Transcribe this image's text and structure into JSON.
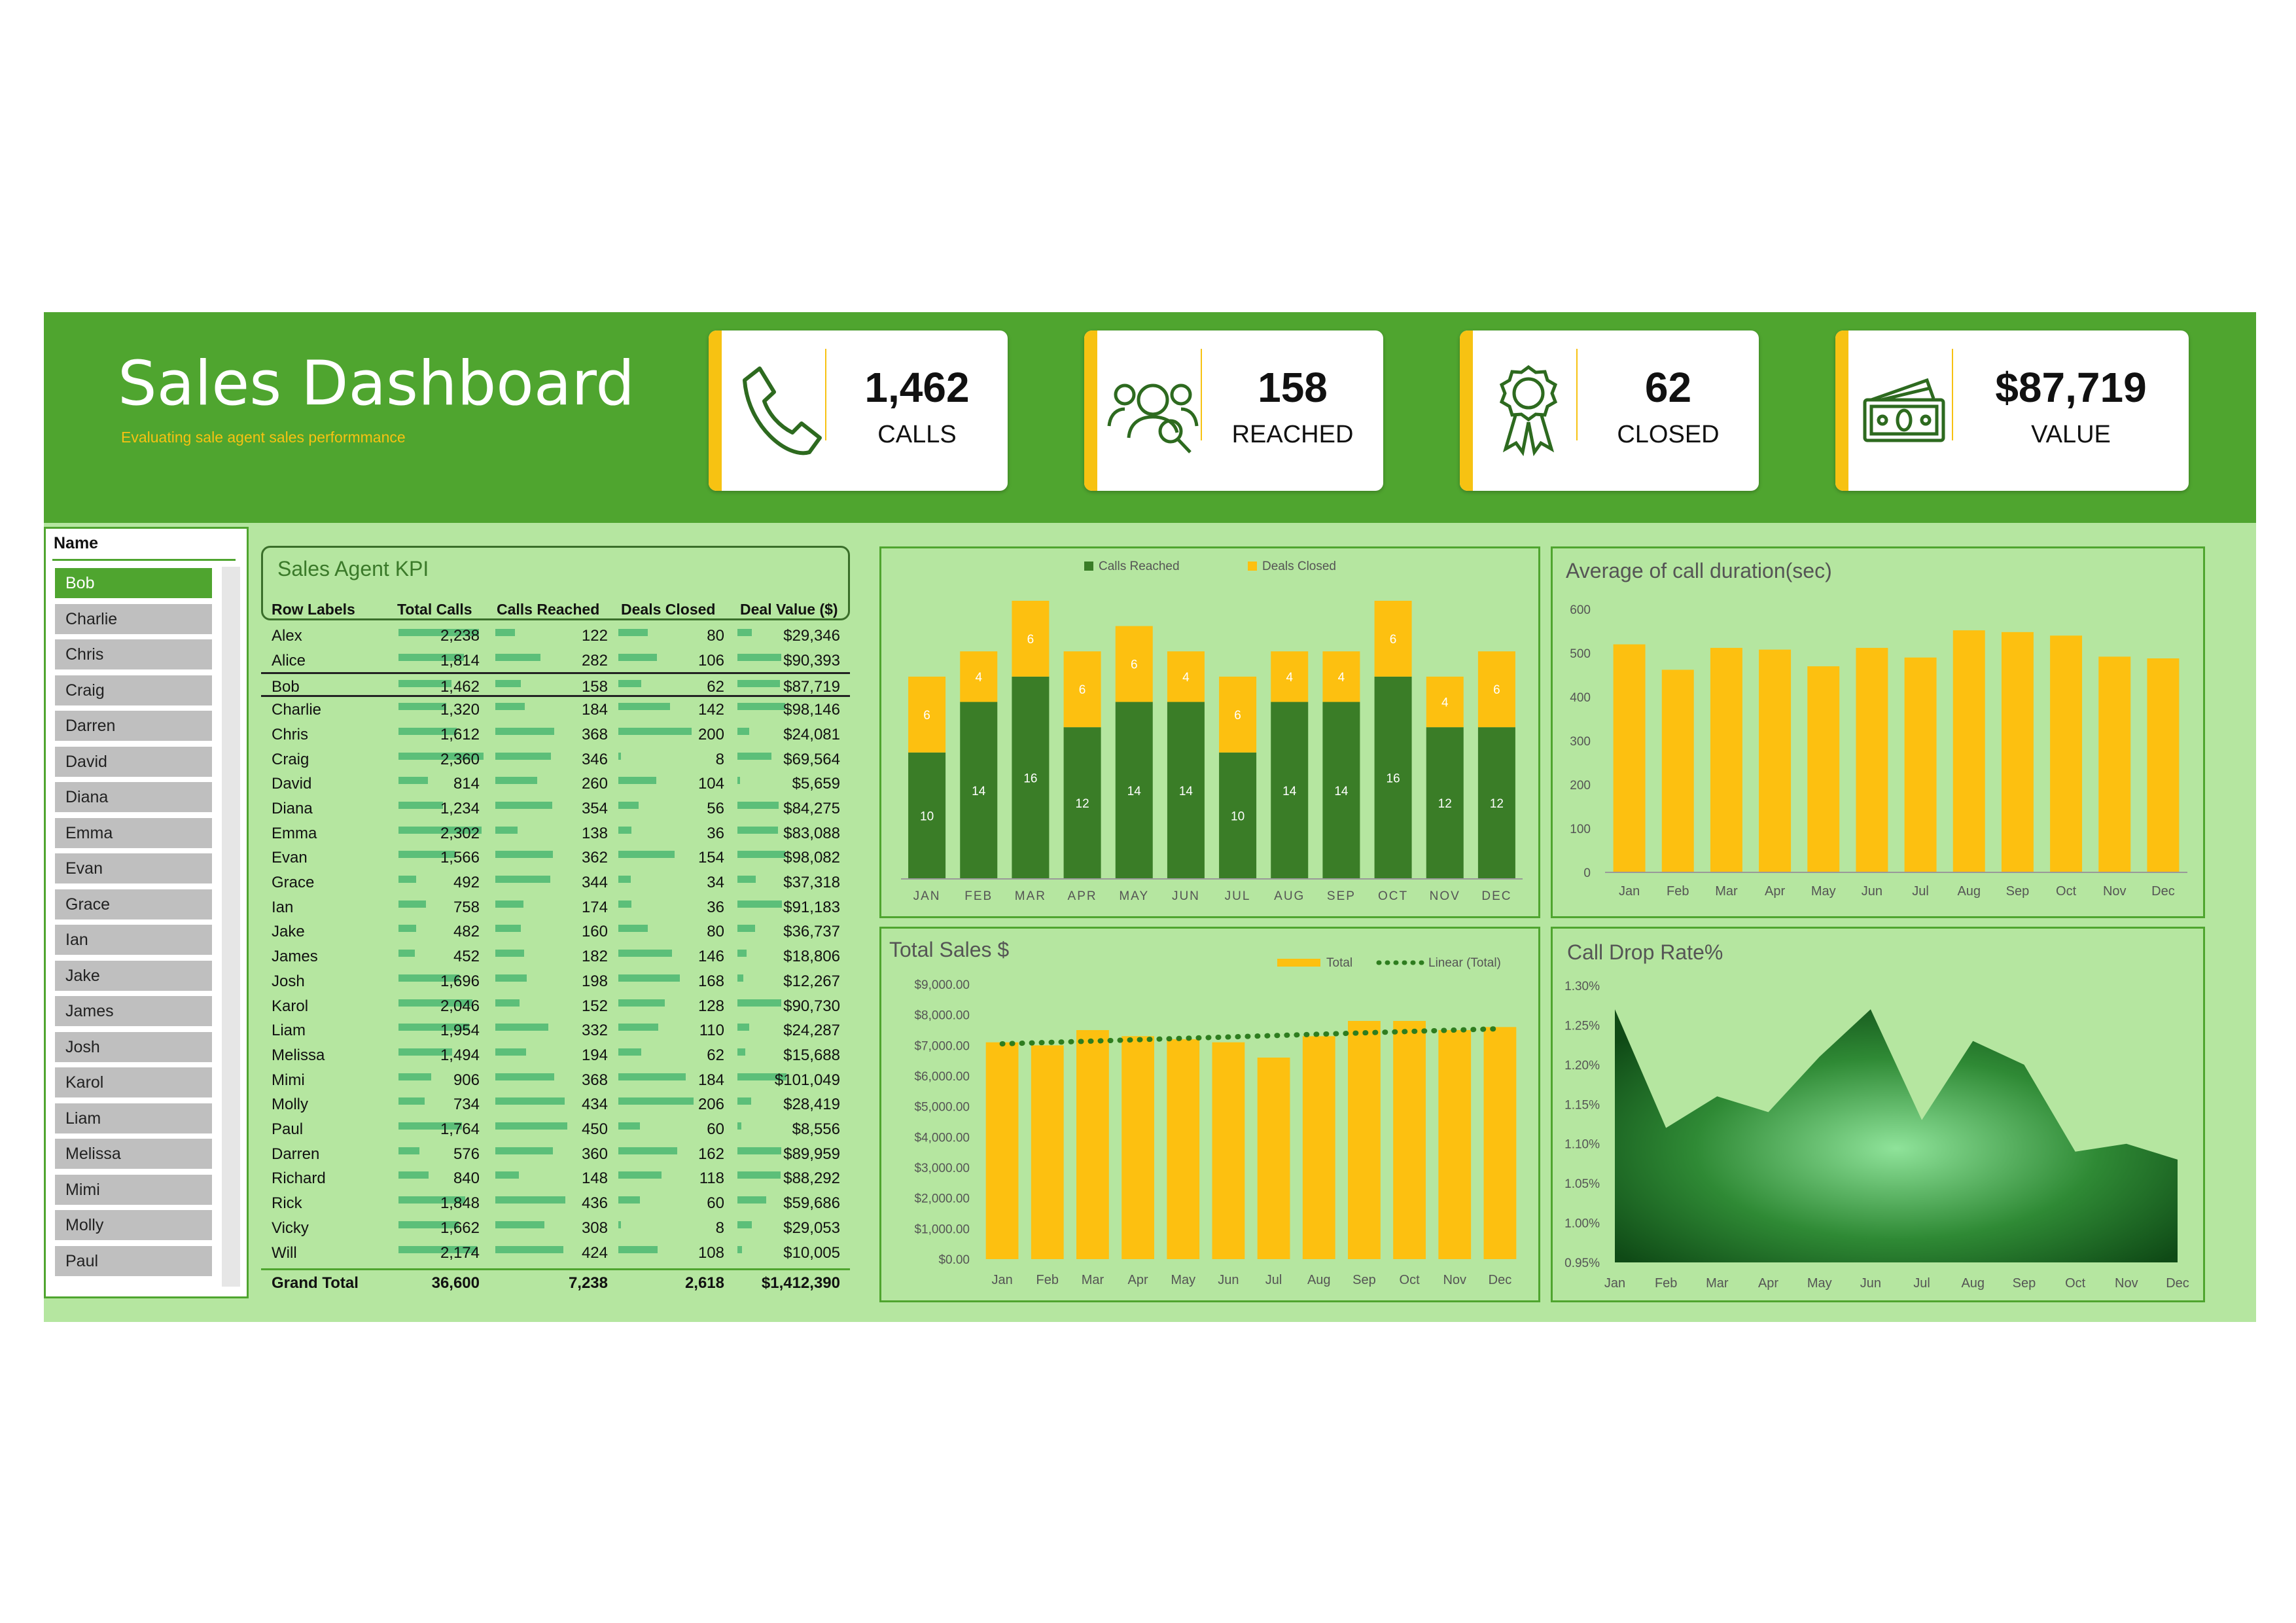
{
  "header": {
    "title": "Sales Dashboard",
    "subtitle": "Evaluating sale agent sales performmance"
  },
  "kpis": [
    {
      "value": "1,462",
      "label": "CALLS",
      "icon": "phone-icon"
    },
    {
      "value": "158",
      "label": "REACHED",
      "icon": "team-search-icon"
    },
    {
      "value": "62",
      "label": "CLOSED",
      "icon": "award-ribbon-icon"
    },
    {
      "value": "$87,719",
      "label": "VALUE",
      "icon": "money-icon"
    }
  ],
  "slicer": {
    "header": "Name",
    "selected": "Bob",
    "items": [
      "Bob",
      "Charlie",
      "Chris",
      "Craig",
      "Darren",
      "David",
      "Diana",
      "Emma",
      "Evan",
      "Grace",
      "Ian",
      "Jake",
      "James",
      "Josh",
      "Karol",
      "Liam",
      "Melissa",
      "Mimi",
      "Molly",
      "Paul"
    ]
  },
  "agent_table": {
    "title": "Sales Agent KPI",
    "columns": [
      "Row Labels",
      "Total Calls",
      "Calls Reached",
      "Deals Closed",
      "Deal Value ($)"
    ],
    "rows": [
      [
        "Alex",
        "2,238",
        "122",
        "80",
        "$29,346"
      ],
      [
        "Alice",
        "1,814",
        "282",
        "106",
        "$90,393"
      ],
      [
        "Bob",
        "1,462",
        "158",
        "62",
        "$87,719"
      ],
      [
        "Charlie",
        "1,320",
        "184",
        "142",
        "$98,146"
      ],
      [
        "Chris",
        "1,612",
        "368",
        "200",
        "$24,081"
      ],
      [
        "Craig",
        "2,360",
        "346",
        "8",
        "$69,564"
      ],
      [
        "David",
        "814",
        "260",
        "104",
        "$5,659"
      ],
      [
        "Diana",
        "1,234",
        "354",
        "56",
        "$84,275"
      ],
      [
        "Emma",
        "2,302",
        "138",
        "36",
        "$83,088"
      ],
      [
        "Evan",
        "1,566",
        "362",
        "154",
        "$98,082"
      ],
      [
        "Grace",
        "492",
        "344",
        "34",
        "$37,318"
      ],
      [
        "Ian",
        "758",
        "174",
        "36",
        "$91,183"
      ],
      [
        "Jake",
        "482",
        "160",
        "80",
        "$36,737"
      ],
      [
        "James",
        "452",
        "182",
        "146",
        "$18,806"
      ],
      [
        "Josh",
        "1,696",
        "198",
        "168",
        "$12,267"
      ],
      [
        "Karol",
        "2,046",
        "152",
        "128",
        "$90,730"
      ],
      [
        "Liam",
        "1,954",
        "332",
        "110",
        "$24,287"
      ],
      [
        "Melissa",
        "1,494",
        "194",
        "62",
        "$15,688"
      ],
      [
        "Mimi",
        "906",
        "368",
        "184",
        "$101,049"
      ],
      [
        "Molly",
        "734",
        "434",
        "206",
        "$28,419"
      ],
      [
        "Paul",
        "1,764",
        "450",
        "60",
        "$8,556"
      ],
      [
        "Darren",
        "576",
        "360",
        "162",
        "$89,959"
      ],
      [
        "Richard",
        "840",
        "148",
        "118",
        "$88,292"
      ],
      [
        "Rick",
        "1,848",
        "436",
        "60",
        "$59,686"
      ],
      [
        "Vicky",
        "1,662",
        "308",
        "8",
        "$29,053"
      ],
      [
        "Will",
        "2,174",
        "424",
        "108",
        "$10,005"
      ]
    ],
    "total": [
      "Grand Total",
      "36,600",
      "7,238",
      "2,618",
      "$1,412,390"
    ]
  },
  "chart_data": [
    {
      "type": "bar",
      "stacked": true,
      "categories": [
        "JAN",
        "FEB",
        "MAR",
        "APR",
        "MAY",
        "JUN",
        "JUL",
        "AUG",
        "SEP",
        "OCT",
        "NOV",
        "DEC"
      ],
      "series": [
        {
          "name": "Calls Reached",
          "values": [
            10,
            14,
            16,
            12,
            14,
            14,
            10,
            14,
            14,
            16,
            12,
            12
          ],
          "color": "#3a7d27"
        },
        {
          "name": "Deals Closed",
          "values": [
            6,
            4,
            6,
            6,
            6,
            4,
            6,
            4,
            4,
            6,
            4,
            6
          ],
          "color": "#fdc010"
        }
      ],
      "legend": "top",
      "ylim": [
        0,
        22
      ]
    },
    {
      "type": "bar",
      "title": "Average of call duration(sec)",
      "categories": [
        "Jan",
        "Feb",
        "Mar",
        "Apr",
        "May",
        "Jun",
        "Jul",
        "Aug",
        "Sep",
        "Oct",
        "Nov",
        "Dec"
      ],
      "values": [
        520,
        462,
        512,
        508,
        470,
        512,
        490,
        552,
        548,
        540,
        492,
        488
      ],
      "yticks": [
        "0",
        "100",
        "200",
        "300",
        "400",
        "500",
        "600"
      ],
      "ylim": [
        0,
        600
      ],
      "color": "#fdc010"
    },
    {
      "type": "bar",
      "title": "Total Sales $",
      "categories": [
        "Jan",
        "Feb",
        "Mar",
        "Apr",
        "May",
        "Jun",
        "Jul",
        "Aug",
        "Sep",
        "Oct",
        "Nov",
        "Dec"
      ],
      "series": [
        {
          "name": "Total",
          "values": [
            7100,
            7000,
            7500,
            7300,
            7200,
            7100,
            6600,
            7300,
            7800,
            7800,
            7500,
            7600
          ],
          "color": "#fdc010"
        },
        {
          "name": "Linear (Total)",
          "values": [
            7050,
            7095,
            7140,
            7185,
            7230,
            7275,
            7320,
            7365,
            7410,
            7455,
            7500,
            7545
          ],
          "color": "#2e7d1f",
          "style": "dotted"
        }
      ],
      "yticks": [
        "$0.00",
        "$1,000.00",
        "$2,000.00",
        "$3,000.00",
        "$4,000.00",
        "$5,000.00",
        "$6,000.00",
        "$7,000.00",
        "$8,000.00",
        "$9,000.00"
      ],
      "ylim": [
        0,
        9000
      ],
      "legend": "top-right"
    },
    {
      "type": "area",
      "title": "Call Drop Rate%",
      "categories": [
        "Jan",
        "Feb",
        "Mar",
        "Apr",
        "May",
        "Jun",
        "Jul",
        "Aug",
        "Sep",
        "Oct",
        "Nov",
        "Dec"
      ],
      "values": [
        1.27,
        1.12,
        1.16,
        1.14,
        1.21,
        1.27,
        1.13,
        1.23,
        1.2,
        1.09,
        1.1,
        1.08
      ],
      "yticks": [
        "0.95%",
        "1.00%",
        "1.05%",
        "1.10%",
        "1.15%",
        "1.20%",
        "1.25%",
        "1.30%"
      ],
      "ylim": [
        0.95,
        1.3
      ]
    }
  ]
}
